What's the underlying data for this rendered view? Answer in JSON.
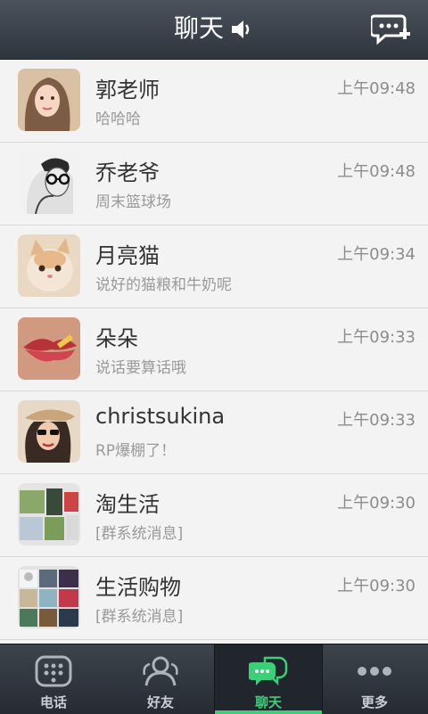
{
  "header": {
    "title": "聊天"
  },
  "conversations": [
    {
      "name": "郭老师",
      "time": "上午09:48",
      "message": "哈哈哈",
      "avatar": "woman-portrait"
    },
    {
      "name": "乔老爷",
      "time": "上午09:48",
      "message": "周末篮球场",
      "avatar": "man-glasses-sketch"
    },
    {
      "name": "月亮猫",
      "time": "上午09:34",
      "message": "说好的猫粮和牛奶呢",
      "avatar": "cat-photo"
    },
    {
      "name": "朵朵",
      "time": "上午09:33",
      "message": "说话要算话哦",
      "avatar": "lips-photo"
    },
    {
      "name": "christsukina",
      "time": "上午09:33",
      "message": "RP爆棚了！",
      "avatar": "woman-sunglasses"
    },
    {
      "name": "淘生活",
      "time": "上午09:30",
      "message": "[群系统消息]",
      "avatar": "group-collage"
    },
    {
      "name": "生活购物",
      "time": "上午09:30",
      "message": "[群系统消息]",
      "avatar": "group-collage"
    }
  ],
  "tabs": [
    {
      "label": "电话",
      "icon": "dialpad-icon"
    },
    {
      "label": "好友",
      "icon": "contacts-icon"
    },
    {
      "label": "聊天",
      "icon": "chat-icon",
      "active": true
    },
    {
      "label": "更多",
      "icon": "more-icon"
    }
  ],
  "colors": {
    "accent": "#3ad07a",
    "header": "#3a4149"
  }
}
